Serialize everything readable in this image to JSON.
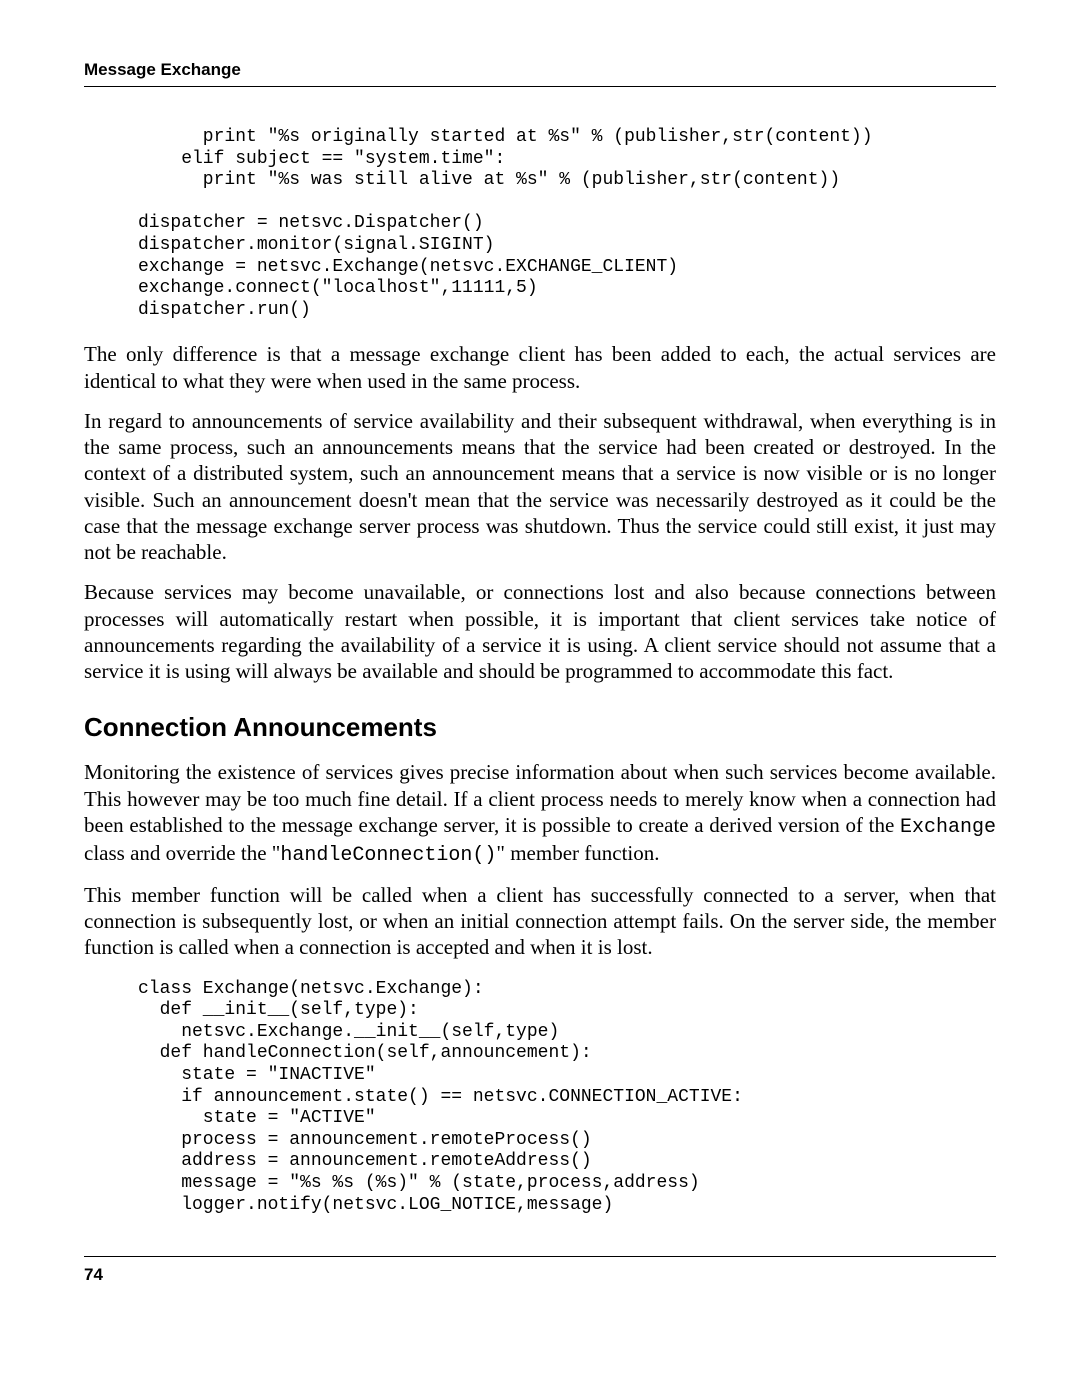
{
  "header": {
    "title": "Message Exchange"
  },
  "codeblock1": "      print \"%s originally started at %s\" % (publisher,str(content))\n    elif subject == \"system.time\":\n      print \"%s was still alive at %s\" % (publisher,str(content))\n\ndispatcher = netsvc.Dispatcher()\ndispatcher.monitor(signal.SIGINT)\nexchange = netsvc.Exchange(netsvc.EXCHANGE_CLIENT)\nexchange.connect(\"localhost\",11111,5)\ndispatcher.run()",
  "para1": "The only difference is that a message exchange client has been added to each, the actual services are identical to what they were when used in the same process.",
  "para2": "In regard to announcements of service availability and their subsequent withdrawal, when everything is in the same process, such an announcements means that the service had been created or destroyed. In the context of a distributed system, such an announcement means that a service is now visible or is no longer visible. Such an announcement doesn't mean that the service was necessarily destroyed as it could be the case that the message exchange server process was shutdown. Thus the service could still exist, it just may not be reachable.",
  "para3": "Because services may become unavailable, or connections lost and also because connections between processes will automatically restart when possible, it is important that client services take notice of announcements regarding the availability of a service it is using. A client service should not assume that a service it is using will always be available and should be programmed to accommodate this fact.",
  "section_heading": "Connection Announcements",
  "para4_a": "Monitoring the existence of services gives precise information about when such services become available. This however may be too much fine detail. If a client process needs to merely know when a connection had been established to the message exchange server, it is possible to create a derived version of the ",
  "para4_code1": "Exchange",
  "para4_b": " class and override the \"",
  "para4_code2": "handleConnection()",
  "para4_c": "\" member function.",
  "para5": "This member function will be called when a client has successfully connected to a server, when that connection is subsequently lost, or when an initial connection attempt fails. On the server side, the member function is called when a connection is accepted and when it is lost.",
  "codeblock2": "class Exchange(netsvc.Exchange):\n  def __init__(self,type):\n    netsvc.Exchange.__init__(self,type)\n  def handleConnection(self,announcement):\n    state = \"INACTIVE\"\n    if announcement.state() == netsvc.CONNECTION_ACTIVE:\n      state = \"ACTIVE\"\n    process = announcement.remoteProcess()\n    address = announcement.remoteAddress()\n    message = \"%s %s (%s)\" % (state,process,address)\n    logger.notify(netsvc.LOG_NOTICE,message)",
  "footer": {
    "page_number": "74"
  }
}
